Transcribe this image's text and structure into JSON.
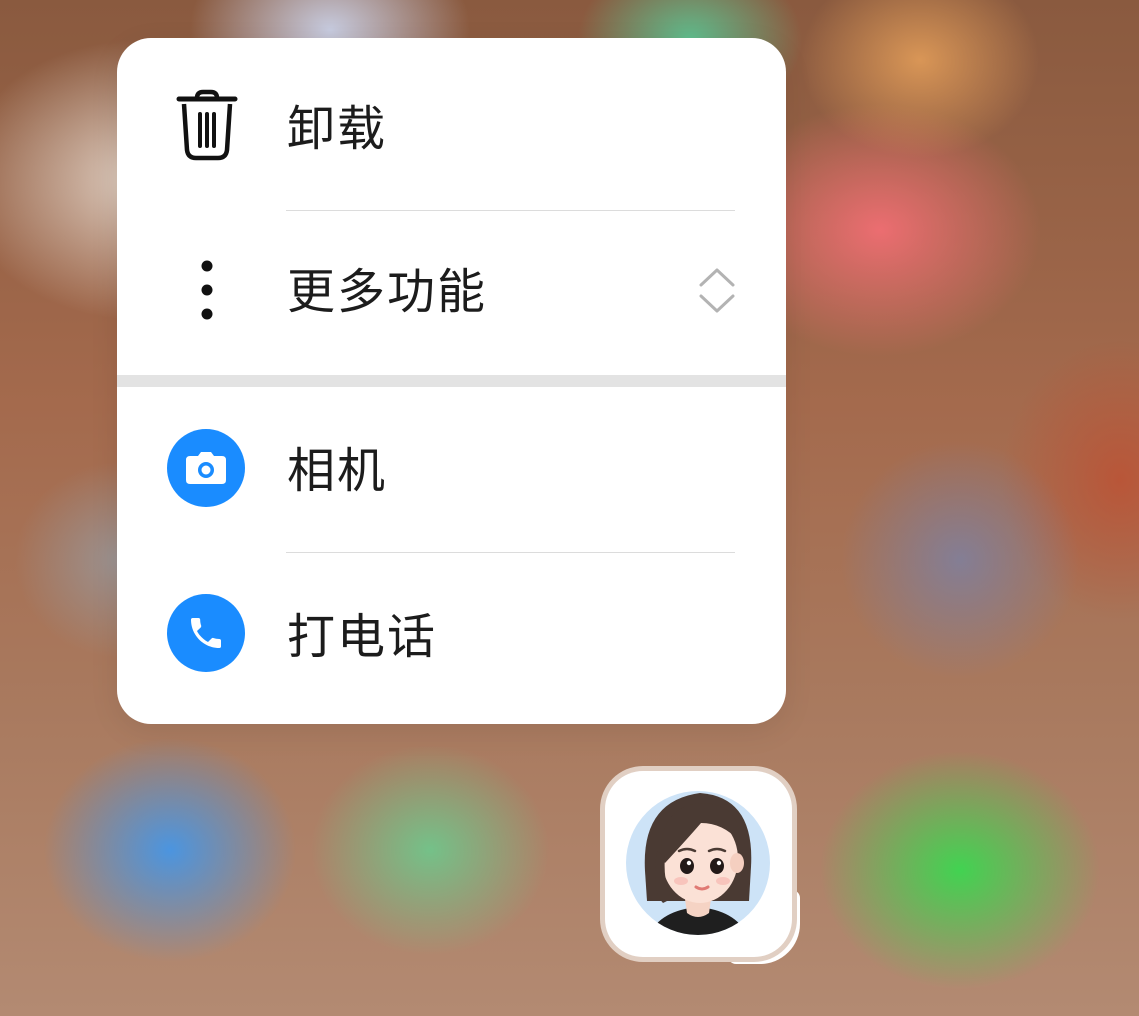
{
  "menu": {
    "items": [
      {
        "label": "卸载",
        "icon": "trash-icon"
      },
      {
        "label": "更多功能",
        "icon": "more-vertical-icon",
        "trailing_icon": "expand-collapse-icon"
      }
    ],
    "shortcuts": [
      {
        "label": "相机",
        "icon": "camera-icon",
        "color": "#1a8cff"
      },
      {
        "label": "打电话",
        "icon": "phone-icon",
        "color": "#1a8cff"
      }
    ]
  },
  "app": {
    "icon": "avatar-girl-icon"
  },
  "colors": {
    "accent": "#1a8cff",
    "menu_bg": "#ffffff",
    "text": "#1c1c1c"
  }
}
